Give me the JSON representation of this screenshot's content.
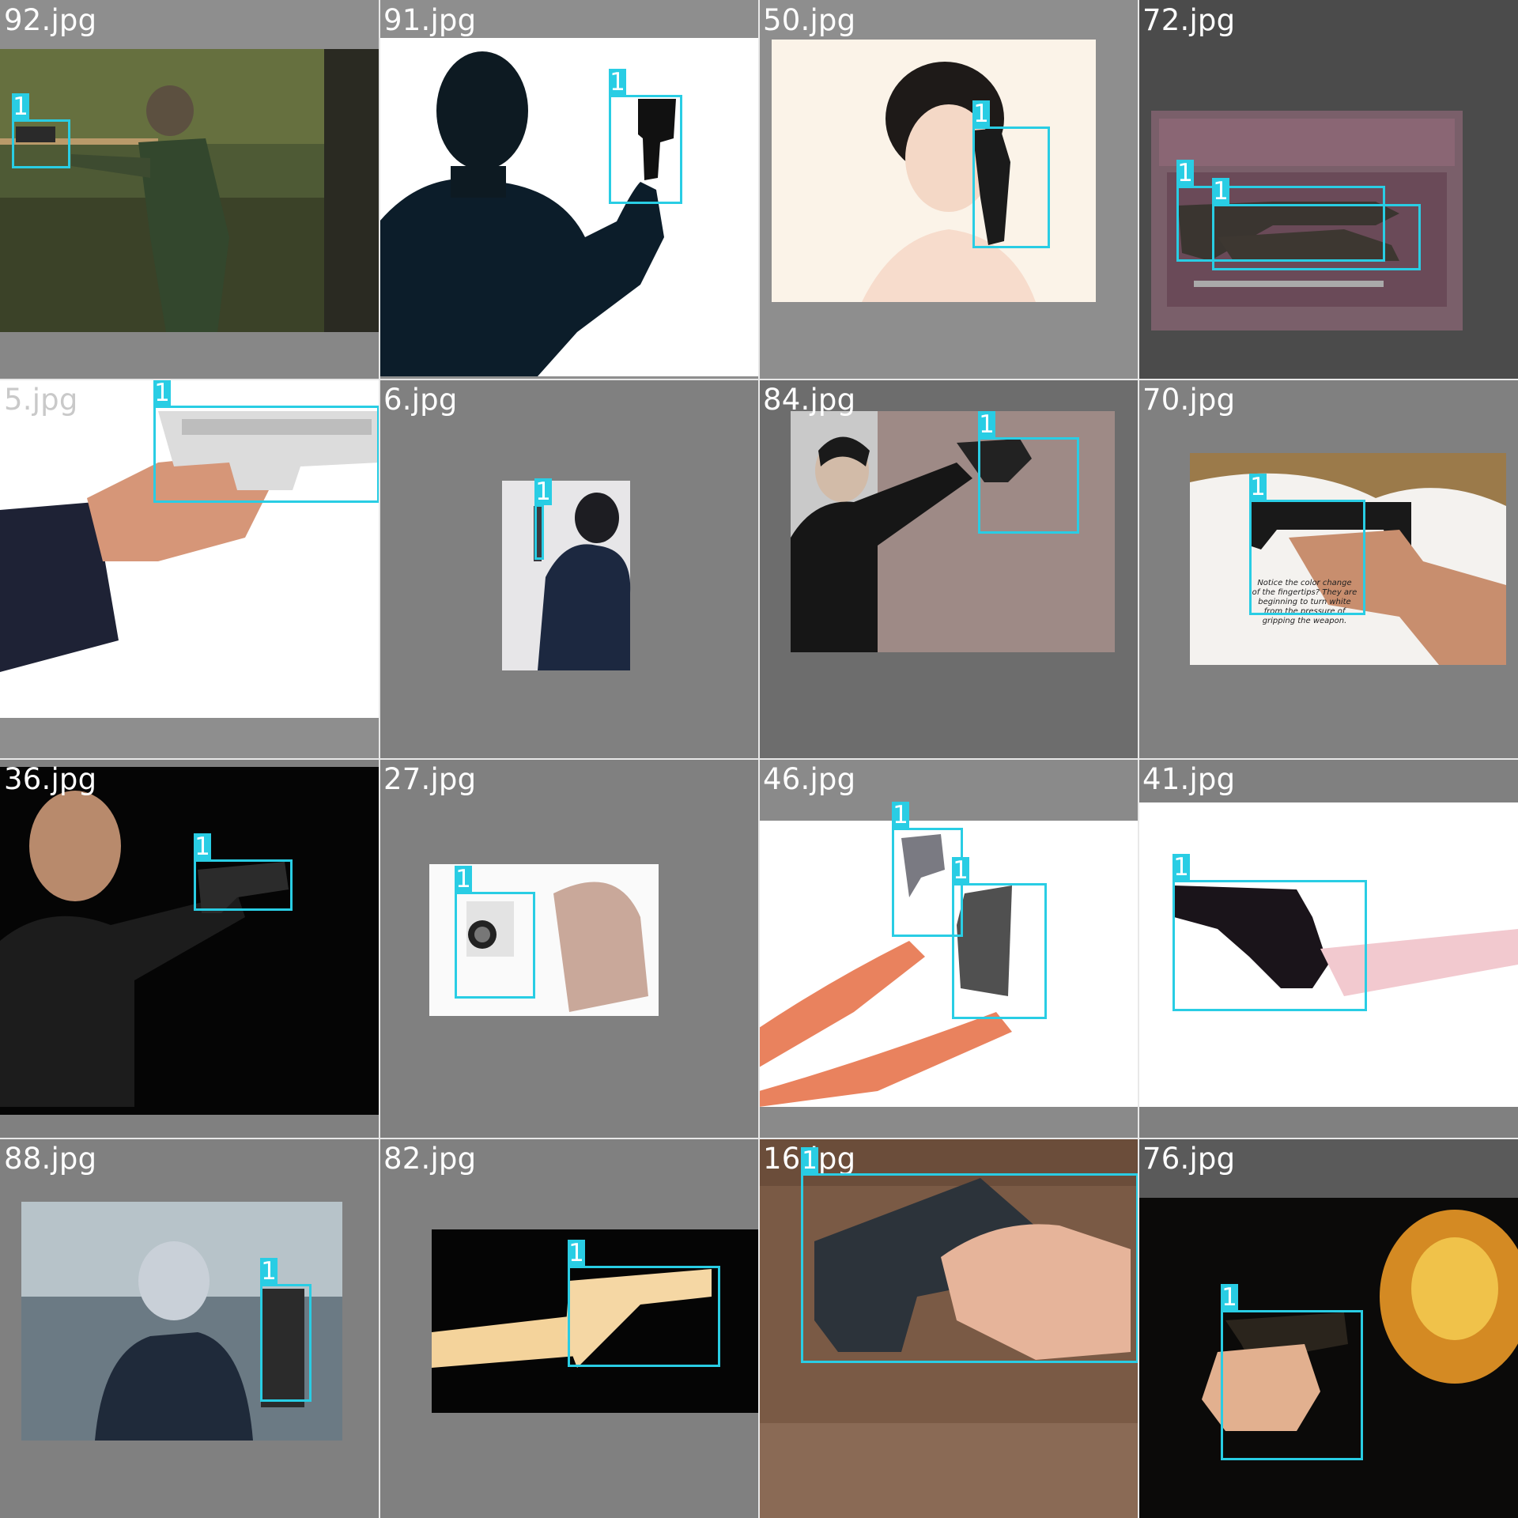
{
  "grid": {
    "tiles": [
      {
        "label": "92.jpg",
        "detections": [
          {
            "class": "1"
          }
        ]
      },
      {
        "label": "91.jpg",
        "detections": [
          {
            "class": "1"
          }
        ]
      },
      {
        "label": "50.jpg",
        "detections": [
          {
            "class": "1"
          }
        ]
      },
      {
        "label": "72.jpg",
        "detections": [
          {
            "class": "1"
          },
          {
            "class": "1"
          }
        ]
      },
      {
        "label": "5.jpg",
        "detections": [
          {
            "class": "1"
          }
        ]
      },
      {
        "label": "6.jpg",
        "detections": [
          {
            "class": "1"
          }
        ]
      },
      {
        "label": "84.jpg",
        "detections": [
          {
            "class": "1"
          }
        ]
      },
      {
        "label": "70.jpg",
        "detections": [
          {
            "class": "1"
          }
        ],
        "caption": [
          "Notice the color change",
          "of the fingertips? They are",
          "beginning to turn white",
          "from the pressure of",
          "gripping the weapon."
        ]
      },
      {
        "label": "36.jpg",
        "detections": [
          {
            "class": "1"
          }
        ]
      },
      {
        "label": "27.jpg",
        "detections": [
          {
            "class": "1"
          }
        ]
      },
      {
        "label": "46.jpg",
        "detections": [
          {
            "class": "1"
          },
          {
            "class": "1"
          }
        ]
      },
      {
        "label": "41.jpg",
        "detections": [
          {
            "class": "1"
          }
        ]
      },
      {
        "label": "88.jpg",
        "detections": [
          {
            "class": "1"
          }
        ]
      },
      {
        "label": "82.jpg",
        "detections": [
          {
            "class": "1"
          }
        ]
      },
      {
        "label": "16.jpg",
        "detections": [
          {
            "class": "1"
          }
        ]
      },
      {
        "label": "76.jpg",
        "detections": [
          {
            "class": "1"
          }
        ]
      }
    ]
  },
  "colors": {
    "box": "#29cde4",
    "label": "#ffffff",
    "background": "#808080"
  }
}
